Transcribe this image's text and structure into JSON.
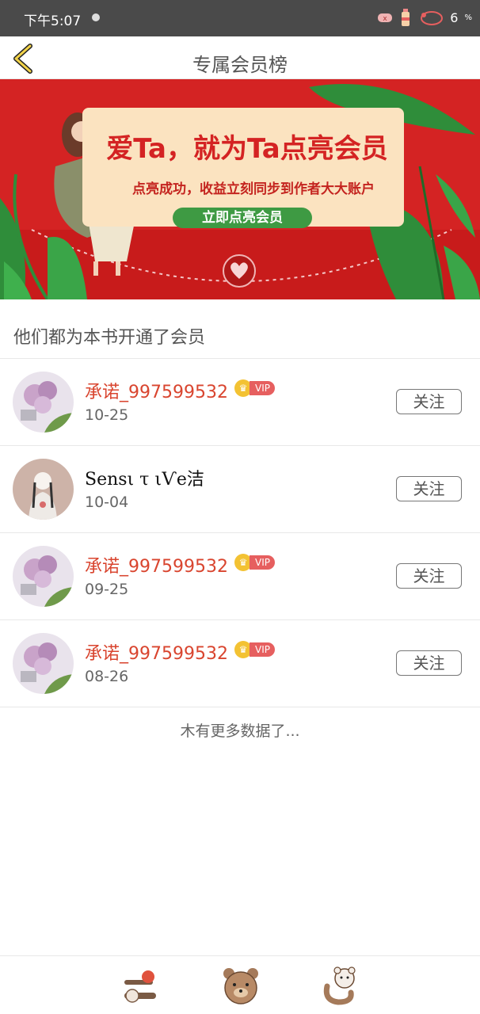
{
  "status_bar": {
    "time": "下午5:07",
    "battery": "6",
    "battery_unit": "%"
  },
  "header": {
    "title": "专属会员榜"
  },
  "banner": {
    "headline": "爱Ta，就为Ta点亮会员",
    "subline": "点亮成功，收益立刻同步到作者大大账户",
    "cta": "立即点亮会员"
  },
  "section_title": "他们都为本书开通了会员",
  "members": [
    {
      "name": "承诺_997599532",
      "date": "10-25",
      "vip": true,
      "follow": "关注",
      "avatar": "flower-avatar"
    },
    {
      "name": "Sensι τ ιѴe洁",
      "date": "10-04",
      "vip": false,
      "follow": "关注",
      "avatar": "girl-avatar"
    },
    {
      "name": "承诺_997599532",
      "date": "09-25",
      "vip": true,
      "follow": "关注",
      "avatar": "flower-avatar"
    },
    {
      "name": "承诺_997599532",
      "date": "08-26",
      "vip": true,
      "follow": "关注",
      "avatar": "flower-avatar"
    }
  ],
  "vip_label": "VIP",
  "no_more": "木有更多数据了...",
  "colors": {
    "accent_red": "#d42323",
    "username_red": "#d9452f",
    "vip_gold": "#f3c233",
    "cta_green": "#3e9a43"
  },
  "bottom_icons": [
    "bear-strawberry-icon",
    "bear-face-icon",
    "bear-hug-icon"
  ]
}
